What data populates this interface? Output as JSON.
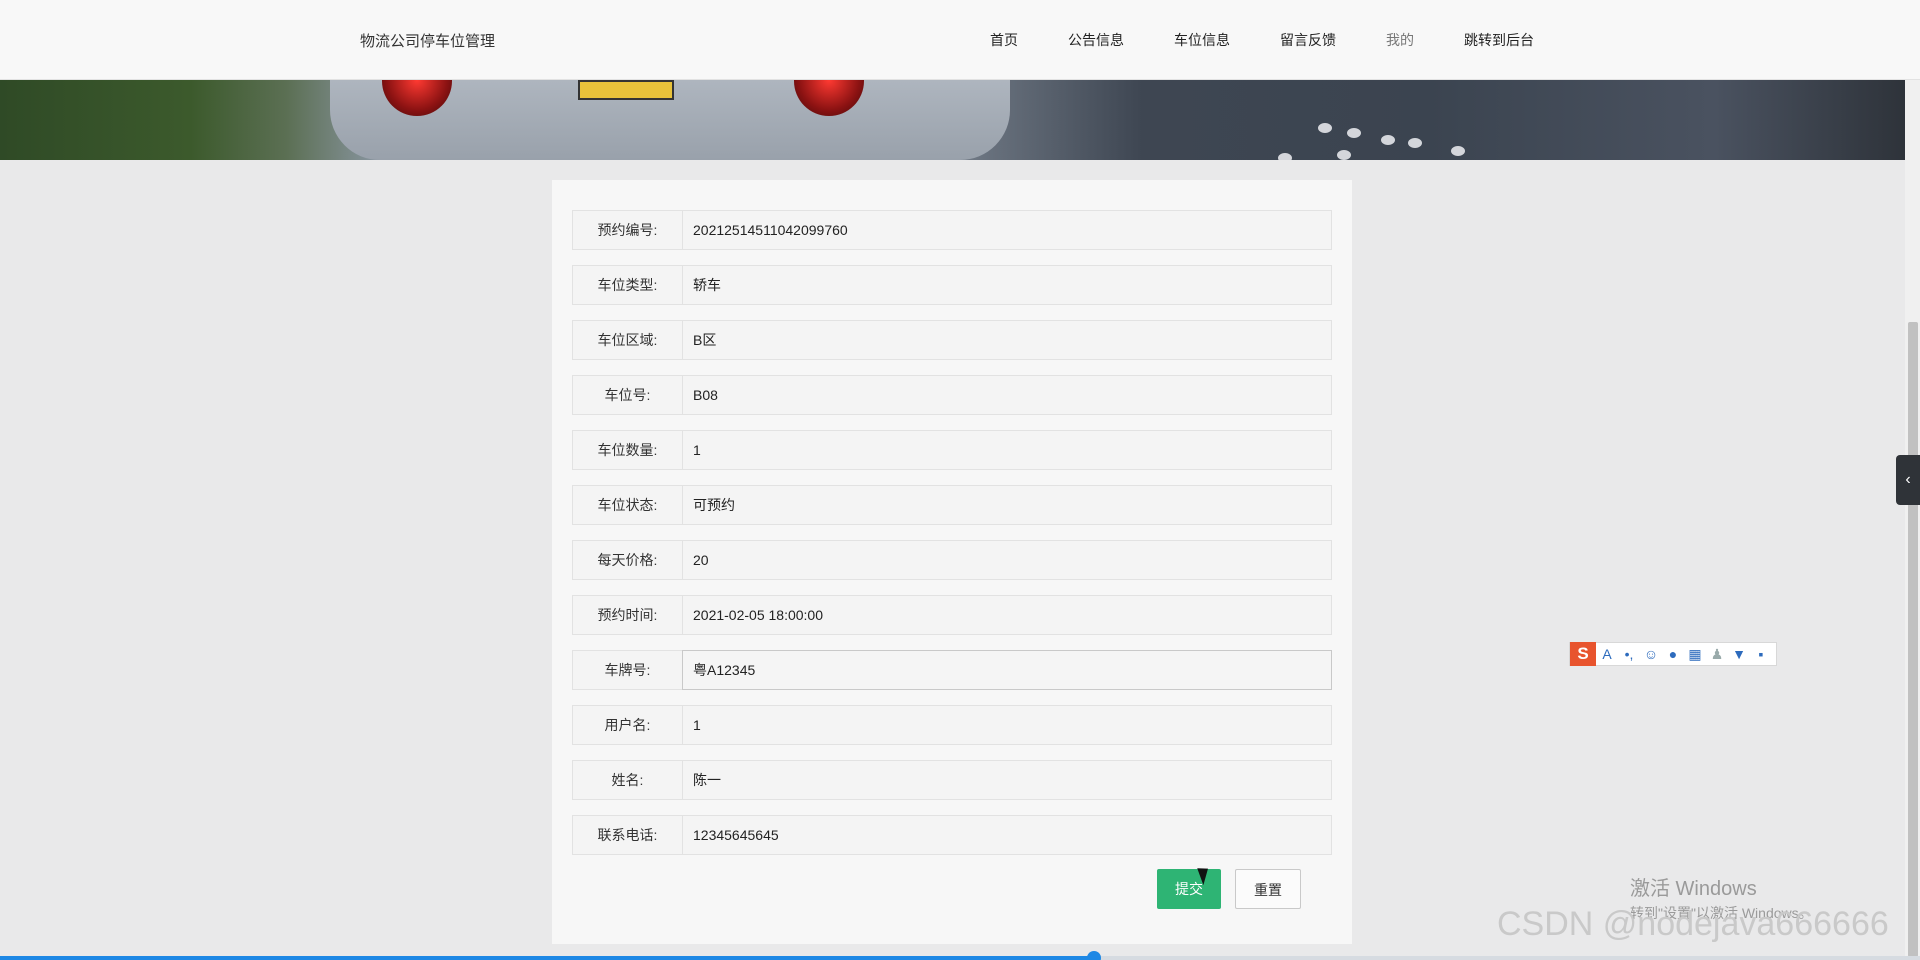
{
  "header": {
    "site_title": "物流公司停车位管理",
    "nav": [
      {
        "label": "首页"
      },
      {
        "label": "公告信息"
      },
      {
        "label": "车位信息"
      },
      {
        "label": "留言反馈"
      },
      {
        "label": "我的"
      },
      {
        "label": "跳转到后台"
      }
    ]
  },
  "form": {
    "fields": [
      {
        "label": "预约编号:",
        "value": "20212514511042099760"
      },
      {
        "label": "车位类型:",
        "value": "轿车"
      },
      {
        "label": "车位区域:",
        "value": "B区"
      },
      {
        "label": "车位号:",
        "value": "B08"
      },
      {
        "label": "车位数量:",
        "value": "1"
      },
      {
        "label": "车位状态:",
        "value": "可预约"
      },
      {
        "label": "每天价格:",
        "value": "20"
      },
      {
        "label": "预约时间:",
        "value": "2021-02-05 18:00:00"
      },
      {
        "label": "车牌号:",
        "value": "粤A12345"
      },
      {
        "label": "用户名:",
        "value": "1"
      },
      {
        "label": "姓名:",
        "value": "陈一"
      },
      {
        "label": "联系电话:",
        "value": "12345645645"
      }
    ],
    "submit_label": "提交",
    "reset_label": "重置"
  },
  "ime_toolbar": {
    "logo": "S",
    "icons": [
      "text-icon",
      "punctuation-icon",
      "emoji-icon",
      "microphone-icon",
      "keyboard-icon",
      "user-icon",
      "skin-icon",
      "toolbox-icon"
    ]
  },
  "watermark": {
    "activate_title": "激活 Windows",
    "activate_sub": "转到\"设置\"以激活 Windows。",
    "csdn": "CSDN @nodejava666666"
  },
  "video_progress": {
    "fraction": 0.57
  },
  "colors": {
    "submit": "#2eb474",
    "progress": "#1e88e5"
  }
}
